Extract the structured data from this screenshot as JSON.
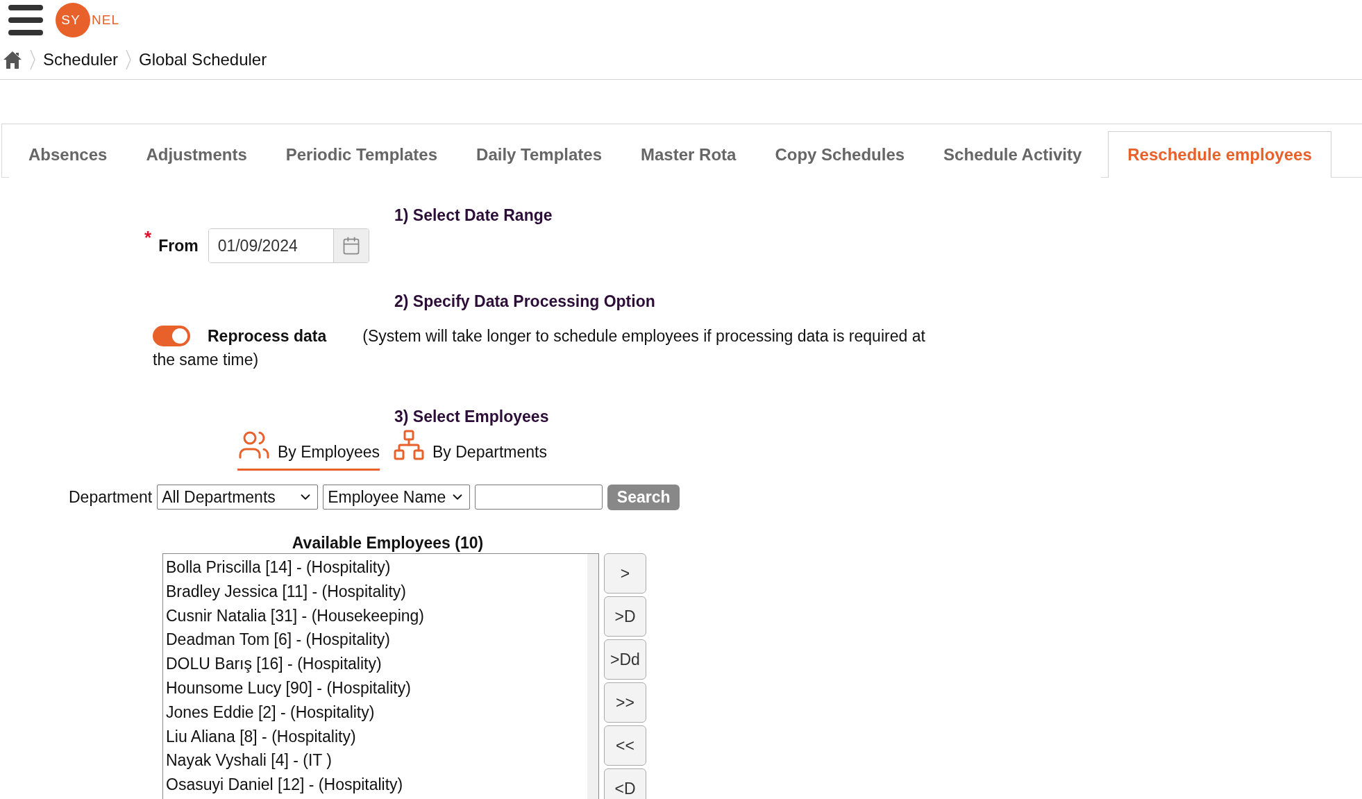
{
  "header": {
    "logo_inner": "SY",
    "logo_outer": "NEL"
  },
  "breadcrumb": [
    "Scheduler",
    "Global Scheduler"
  ],
  "tabs": [
    {
      "label": "Absences",
      "selected": false
    },
    {
      "label": "Adjustments",
      "selected": false
    },
    {
      "label": "Periodic Templates",
      "selected": false
    },
    {
      "label": "Daily Templates",
      "selected": false
    },
    {
      "label": "Master Rota",
      "selected": false
    },
    {
      "label": "Copy Schedules",
      "selected": false
    },
    {
      "label": "Schedule Activity",
      "selected": false
    },
    {
      "label": "Reschedule employees",
      "selected": true
    }
  ],
  "date_section": {
    "heading": "1) Select Date Range",
    "required_mark": "*",
    "label": "From",
    "value": "01/09/2024"
  },
  "processing_section": {
    "heading": "2) Specify Data Processing Option",
    "toggle": {
      "label": "Reprocess data",
      "on": true
    },
    "note_lines": [
      "(System will take longer to schedule employees if processing data is required at",
      "the same time)"
    ]
  },
  "employees_section": {
    "heading": "3) Select Employees",
    "modes": [
      {
        "kind": "employees",
        "label": "By Employees",
        "selected": true
      },
      {
        "kind": "departments",
        "label": "By Departments",
        "selected": false
      }
    ],
    "filter": {
      "label": "Department",
      "department": "All Departments",
      "field": "Employee Name",
      "search_button": "Search"
    },
    "available": {
      "title": "Available Employees (10)",
      "items": [
        "Bolla Priscilla [14] - (Hospitality)",
        "Bradley Jessica [11] - (Hospitality)",
        "Cusnir Natalia [31] - (Housekeeping)",
        "Deadman Tom [6] - (Hospitality)",
        "DOLU Barış [16] - (Hospitality)",
        "Hounsome Lucy [90] - (Hospitality)",
        "Jones Eddie [2] - (Hospitality)",
        "Liu Aliana [8] - (Hospitality)",
        "Nayak Vyshali [4] - (IT )",
        "Osasuyi Daniel [12] - (Hospitality)"
      ]
    },
    "move_buttons": [
      ">",
      ">D",
      ">Dd",
      ">>",
      "<<",
      "<D"
    ]
  }
}
